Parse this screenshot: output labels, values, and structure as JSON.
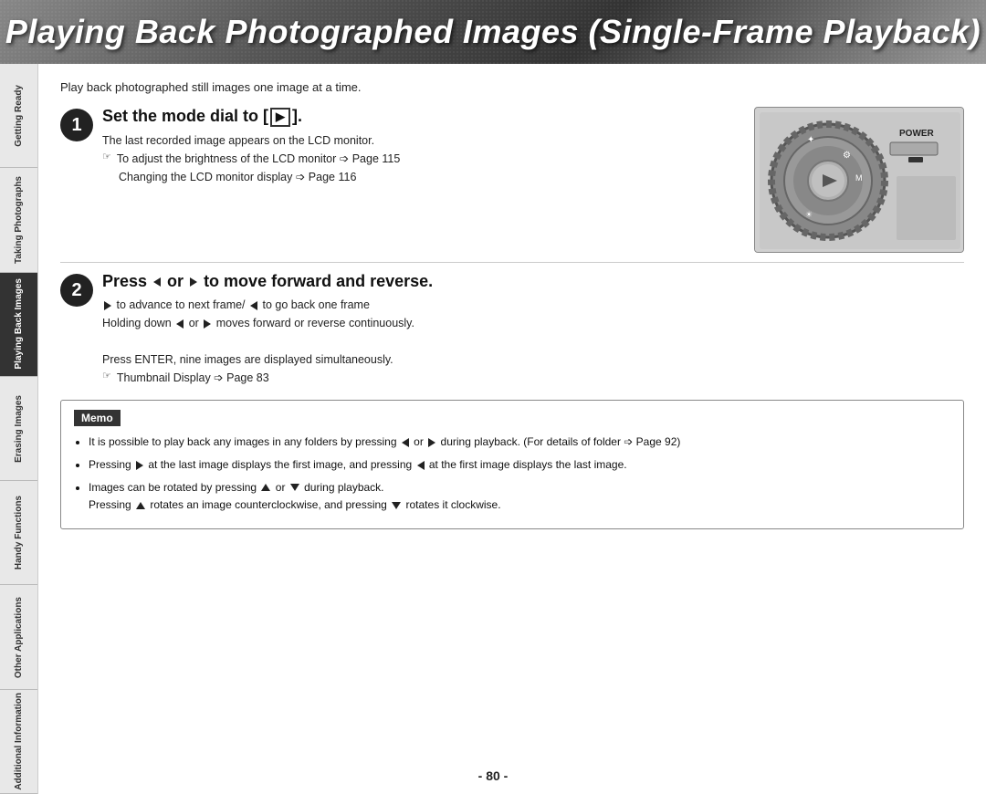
{
  "header": {
    "title": "Playing Back Photographed Images (Single-Frame Playback)"
  },
  "intro": {
    "text": "Play back photographed still images one image at a time."
  },
  "step1": {
    "number": "1",
    "title_pre": "Set the mode dial to [",
    "title_post": "].",
    "title_icon": "▶",
    "body_line1": "The last recorded image appears on the LCD monitor.",
    "note1": "To adjust the brightness of the LCD monitor ➩ Page 115",
    "note1_sub": "Changing the LCD monitor display ➩ Page 116"
  },
  "step2": {
    "number": "2",
    "title": "Press ◀ or ▶ to move forward and reverse.",
    "line1": "▶ to advance to next frame/ ◀ to go back one frame",
    "line2": "Holding down ◀ or ▶ moves forward or reverse continuously.",
    "line3": "Press ENTER, nine images are displayed simultaneously.",
    "note1": "Thumbnail Display ➩ Page 83"
  },
  "memo": {
    "header": "Memo",
    "bullets": [
      "It is possible to play back any images in any folders by pressing ◀ or ▶ during playback. (For details of folder ➩ Page 92)",
      "Pressing ▶ at the last image displays the first image, and pressing ◀ at the first image displays the last image.",
      "Images can be rotated by pressing ▲ or ▼ during playback. Pressing ▲ rotates an image counterclockwise, and pressing ▼ rotates it clockwise."
    ]
  },
  "sidebar": {
    "items": [
      {
        "label": "Getting\nReady",
        "active": false
      },
      {
        "label": "Taking\nPhotographs",
        "active": false
      },
      {
        "label": "Playing\nBack Images",
        "active": true
      },
      {
        "label": "Erasing\nImages",
        "active": false
      },
      {
        "label": "Handy\nFunctions",
        "active": false
      },
      {
        "label": "Other\nApplications",
        "active": false
      },
      {
        "label": "Additional\nInformation",
        "active": false
      }
    ]
  },
  "page_number": "- 80 -",
  "camera": {
    "power_label": "POWER"
  }
}
